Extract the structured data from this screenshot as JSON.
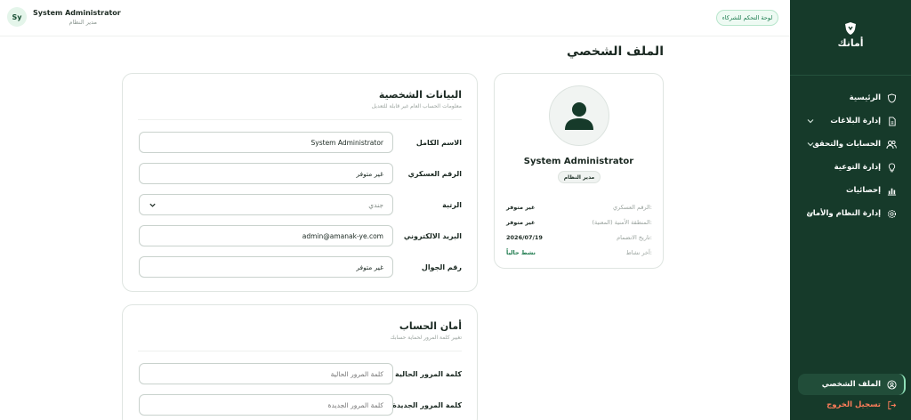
{
  "header": {
    "avatar_initials": "Sy",
    "user_name": "System Administrator",
    "user_role": "مدير النظام",
    "partner_dashboard": "لوحة التحكم للشركاء"
  },
  "sidebar": {
    "logo_text": "أمانك",
    "items": [
      {
        "label": "الرئيسية",
        "icon": "shield-icon"
      },
      {
        "label": "إدارة البلاغات",
        "icon": "document-icon"
      },
      {
        "label": "الحسابات والتحقق",
        "icon": "users-icon"
      },
      {
        "label": "إدارة التوعية",
        "icon": "lightbulb-icon"
      },
      {
        "label": "إحصائيات",
        "icon": "bar-chart-icon"
      },
      {
        "label": "إدارة النظام والأمان",
        "icon": "gear-icon"
      }
    ],
    "profile_label": "الملف الشخصي",
    "logout_label": "تسجيل الخروج"
  },
  "page": {
    "title": "الملف الشخصي"
  },
  "profile_card": {
    "name": "System Administrator",
    "role": "مدير النظام",
    "rows": [
      {
        "label": "الرقم العسكري:",
        "value": "غير متوفر"
      },
      {
        "label": "المنطقة الأمنية (المعنية):",
        "value": "غير متوفر"
      },
      {
        "label": "تاريخ الانضمام:",
        "value": "2026/07/19"
      },
      {
        "label": "آخر نشاط:",
        "value": "نشط حالياً"
      }
    ]
  },
  "personal": {
    "title": "البيانات الشخصية",
    "subtitle": "معلومات الحساب العام غير قابلة للتعديل",
    "fields": [
      {
        "label": "الاسم الكامل",
        "value": "System Administrator"
      },
      {
        "label": "الرقم العسكري",
        "value": "غير متوفر"
      },
      {
        "label": "الرتبة",
        "placeholder": "جندي"
      },
      {
        "label": "البريد الالكتروني",
        "value": "admin@amanak-ye.com"
      },
      {
        "label": "رقم الجوال",
        "value": "غير متوفر"
      }
    ]
  },
  "security": {
    "title": "أمان الحساب",
    "subtitle": "تغيير كلمة المرور لحماية حسابك",
    "fields": [
      {
        "label": "كلمة المرور الحالية",
        "placeholder": "كلمة المرور الحالية"
      },
      {
        "label": "كلمة المرور الجديدة",
        "placeholder": "كلمة المرور الجديدة"
      }
    ]
  },
  "colors": {
    "sidebar_bg": "#163a2a",
    "accent_green": "#1d7a4d",
    "logout": "#ff7d5a"
  }
}
